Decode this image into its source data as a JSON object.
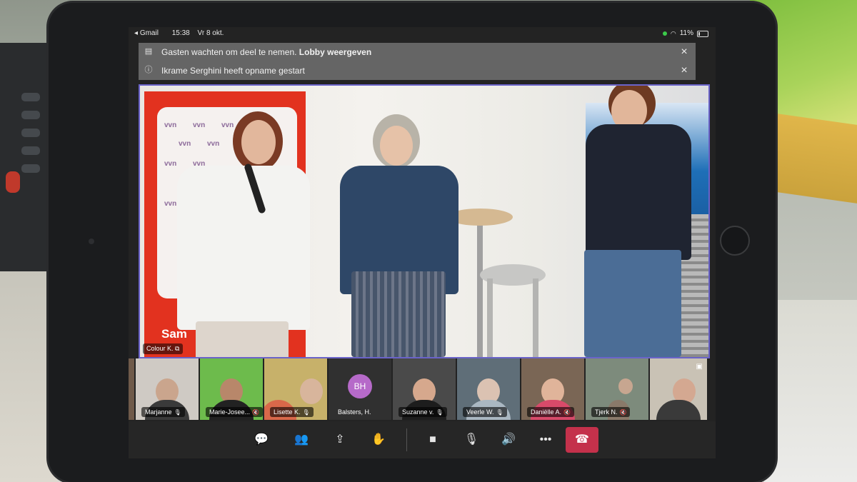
{
  "status_bar": {
    "back_app": "Gmail",
    "time": "15:38",
    "date": "Vr 8 okt.",
    "battery": "11%"
  },
  "notices": [
    {
      "text": "Gasten wachten om deel te nemen.",
      "link": "Lobby weergeven"
    },
    {
      "text": "Ikrame Serghini heeft opname gestart"
    }
  ],
  "stage": {
    "presenter_label": "Colour K.",
    "banner_text": "Sam",
    "banner_logo": "vvn"
  },
  "participants": [
    {
      "name": "Marjanne"
    },
    {
      "name": "Marie-Josee..."
    },
    {
      "name": "Lisette K."
    },
    {
      "name": "Balsters, H.",
      "initials": "BH"
    },
    {
      "name": "Suzanne v."
    },
    {
      "name": "Veerle W."
    },
    {
      "name": "Daniëlle A."
    },
    {
      "name": "Tjerk N."
    },
    {
      "name": ""
    }
  ],
  "colors": {
    "hangup": "#c4314b",
    "avatar": "#b66ac9",
    "active_speaker_border": "#6a63c9"
  }
}
